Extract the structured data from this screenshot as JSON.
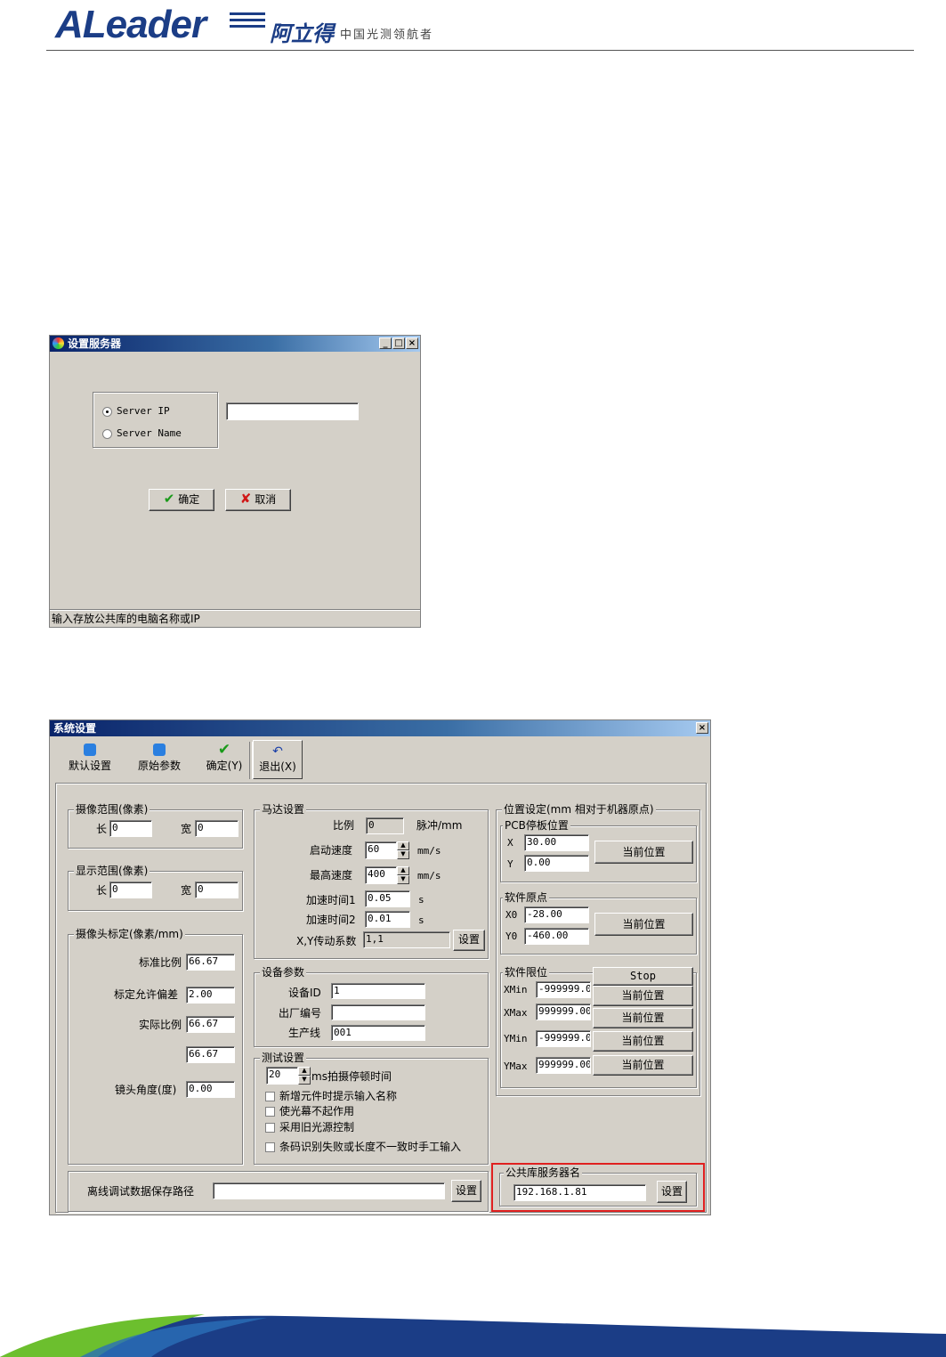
{
  "header": {
    "logo_text": "ALeader",
    "logo_cn": "阿立得",
    "tagline": "中国光测领航者"
  },
  "dialog1": {
    "title": "设置服务器",
    "options": [
      "Server IP",
      "Server Name"
    ],
    "selected": "Server IP",
    "input_value": "",
    "ok_label": "确定",
    "cancel_label": "取消",
    "status": "输入存放公共库的电脑名称或IP"
  },
  "dialog2": {
    "title": "系统设置",
    "toolbar": [
      "默认设置",
      "原始参数",
      "确定(Y)",
      "退出(X)"
    ],
    "capture_range": {
      "legend": "摄像范围(像素)",
      "len_label": "长",
      "len": "0",
      "width_label": "宽",
      "width": "0"
    },
    "display_range": {
      "legend": "显示范围(像素)",
      "len_label": "长",
      "len": "0",
      "width_label": "宽",
      "width": "0"
    },
    "calib": {
      "legend": "摄像头标定(像素/mm)",
      "std_label": "标准比例",
      "std": "66.67",
      "tol_label": "标定允许偏差",
      "tol": "2.00",
      "actual_label": "实际比例",
      "actual": "66.67",
      "extra": "66.67",
      "angle_label": "镜头角度(度)",
      "angle": "0.00"
    },
    "motor": {
      "legend": "马达设置",
      "ratio_label": "比例",
      "ratio": "0",
      "ratio_unit": "脉冲/mm",
      "start_label": "启动速度",
      "start": "60",
      "start_unit": "mm/s",
      "max_label": "最高速度",
      "max": "400",
      "max_unit": "mm/s",
      "acc1_label": "加速时间1",
      "acc1": "0.05",
      "acc1_unit": "s",
      "acc2_label": "加速时间2",
      "acc2": "0.01",
      "acc2_unit": "s",
      "coef_label": "X,Y传动系数",
      "coef": "1,1",
      "set_label": "设置"
    },
    "device": {
      "legend": "设备参数",
      "id_label": "设备ID",
      "id": "1",
      "serial_label": "出厂编号",
      "serial": "",
      "line_label": "生产线",
      "line": "001"
    },
    "test": {
      "legend": "测试设置",
      "delay": "20",
      "delay_label": "ms拍摄停顿时间",
      "checks": [
        "新增元件时提示输入名称",
        "使光幕不起作用",
        "采用旧光源控制",
        "条码识别失败或长度不一致时手工输入"
      ]
    },
    "position": {
      "legend": "位置设定(mm 相对于机器原点)",
      "pcb_legend": "PCB停板位置",
      "x_label": "X",
      "x": "30.00",
      "y_label": "Y",
      "y": "0.00",
      "current_label": "当前位置",
      "origin_legend": "软件原点",
      "x0_label": "X0",
      "x0": "-28.00",
      "y0_label": "Y0",
      "y0": "-460.00",
      "limit_legend": "软件限位",
      "stop_label": "Stop",
      "xmin_label": "XMin",
      "xmin": "-999999.0",
      "xmax_label": "XMax",
      "xmax": "999999.00",
      "ymin_label": "YMin",
      "ymin": "-999999.0",
      "ymax_label": "YMax",
      "ymax": "999999.00"
    },
    "offline": {
      "label": "离线调试数据保存路径",
      "value": "",
      "set_label": "设置"
    },
    "server": {
      "legend": "公共库服务器名",
      "value": "192.168.1.81",
      "set_label": "设置"
    }
  },
  "colors": {
    "title_bar": "#0a246a",
    "window_bg": "#d4d0c8",
    "highlight_box": "#e02020",
    "brand_blue": "#1b3d86",
    "brand_green": "#6cbf2e"
  }
}
